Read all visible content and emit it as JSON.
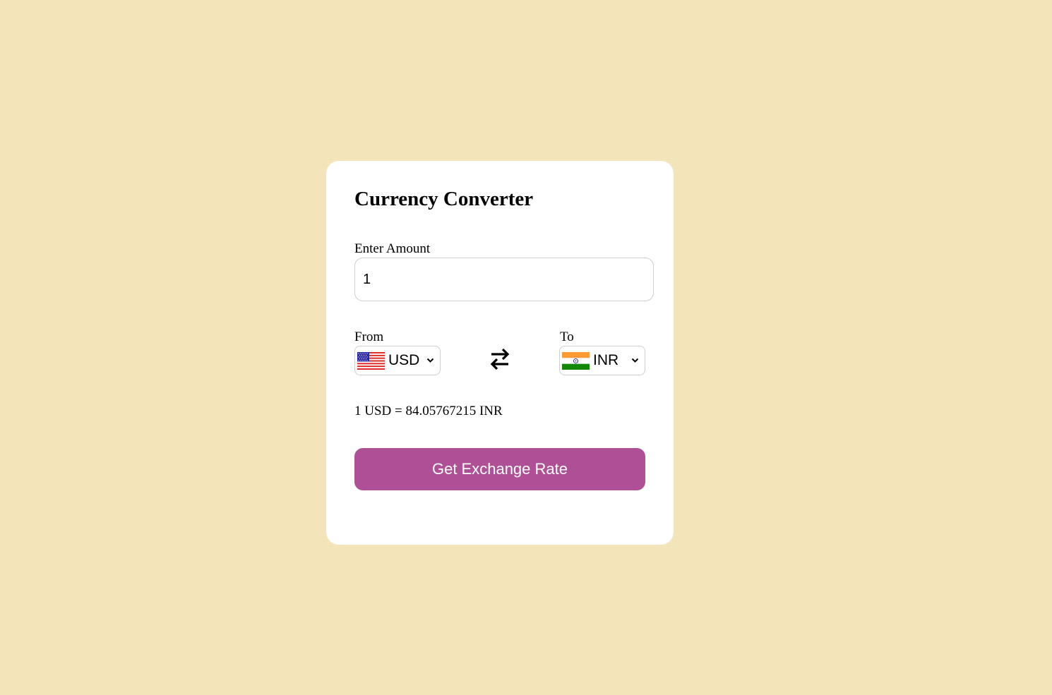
{
  "title": "Currency Converter",
  "amount": {
    "label": "Enter Amount",
    "value": "1"
  },
  "from": {
    "label": "From",
    "currency": "USD",
    "flag_icon": "us-flag-icon"
  },
  "to": {
    "label": "To",
    "currency": "INR",
    "flag_icon": "india-flag-icon"
  },
  "swap_icon": "swap-arrows-icon",
  "result_text": "1 USD = 84.05767215 INR",
  "button": {
    "label": "Get Exchange Rate"
  },
  "colors": {
    "background": "#f3e4ba",
    "card": "#ffffff",
    "button": "#af5097",
    "button_text": "#ffffff"
  }
}
